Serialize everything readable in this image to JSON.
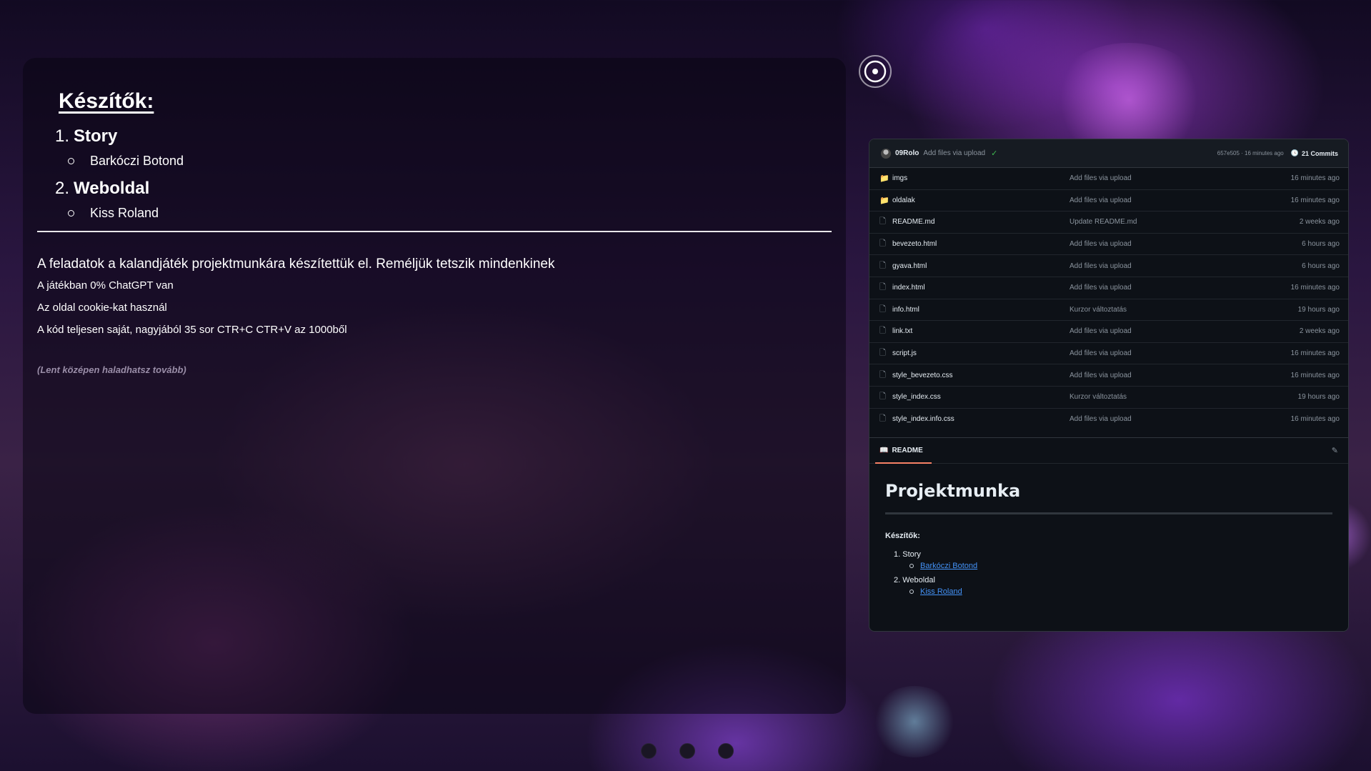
{
  "credits": {
    "title": "Készítők:",
    "roles": [
      {
        "number": "1.",
        "role": "Story",
        "person": "Barkóczi Botond"
      },
      {
        "number": "2.",
        "role": "Weboldal",
        "person": "Kiss Roland"
      }
    ]
  },
  "intro": {
    "main": "A feladatok a kalandjáték projektmunkára készítettük el. Reméljük tetszik mindenkinek",
    "lines": [
      "A játékban 0% ChatGPT van",
      "Az oldal cookie-kat használ",
      "A kód teljesen saját, nagyjából 35 sor CTR+C CTR+V az 1000ből"
    ],
    "hint": "(Lent középen haladhatsz tovább)"
  },
  "repo": {
    "header": {
      "user": "09Rolo",
      "message": "Add files via upload",
      "meta": "657e505 · 16 minutes ago",
      "commits": "21 Commits"
    },
    "files": [
      {
        "type": "dir",
        "name": "imgs",
        "commit": "Add files via upload",
        "time": "16 minutes ago"
      },
      {
        "type": "dir",
        "name": "oldalak",
        "commit": "Add files via upload",
        "time": "16 minutes ago"
      },
      {
        "type": "file",
        "name": "README.md",
        "commit": "Update README.md",
        "time": "2 weeks ago"
      },
      {
        "type": "file",
        "name": "bevezeto.html",
        "commit": "Add files via upload",
        "time": "6 hours ago"
      },
      {
        "type": "file",
        "name": "gyava.html",
        "commit": "Add files via upload",
        "time": "6 hours ago"
      },
      {
        "type": "file",
        "name": "index.html",
        "commit": "Add files via upload",
        "time": "16 minutes ago"
      },
      {
        "type": "file",
        "name": "info.html",
        "commit": "Kurzor változtatás",
        "time": "19 hours ago"
      },
      {
        "type": "file",
        "name": "link.txt",
        "commit": "Add files via upload",
        "time": "2 weeks ago"
      },
      {
        "type": "file",
        "name": "script.js",
        "commit": "Add files via upload",
        "time": "16 minutes ago"
      },
      {
        "type": "file",
        "name": "style_bevezeto.css",
        "commit": "Add files via upload",
        "time": "16 minutes ago"
      },
      {
        "type": "file",
        "name": "style_index.css",
        "commit": "Kurzor változtatás",
        "time": "19 hours ago"
      },
      {
        "type": "file",
        "name": "style_index.info.css",
        "commit": "Add files via upload",
        "time": "16 minutes ago"
      }
    ],
    "readme": {
      "tab": "README",
      "title": "Projektmunka",
      "subtitle": "Készítők:",
      "items": [
        {
          "role": "1. Story",
          "person": "Barkóczi Botond"
        },
        {
          "role": "2. Weboldal",
          "person": "Kiss Roland"
        }
      ]
    }
  },
  "icons": {
    "folder": "📁",
    "file": "🗋",
    "check": "✓",
    "clock": "🕓",
    "book": "📖",
    "pencil": "✎"
  },
  "colors": {
    "gh_bg": "#0d1117",
    "gh_link": "#4493f8",
    "gh_check": "#3fb950",
    "tab_underline": "#f78166"
  }
}
